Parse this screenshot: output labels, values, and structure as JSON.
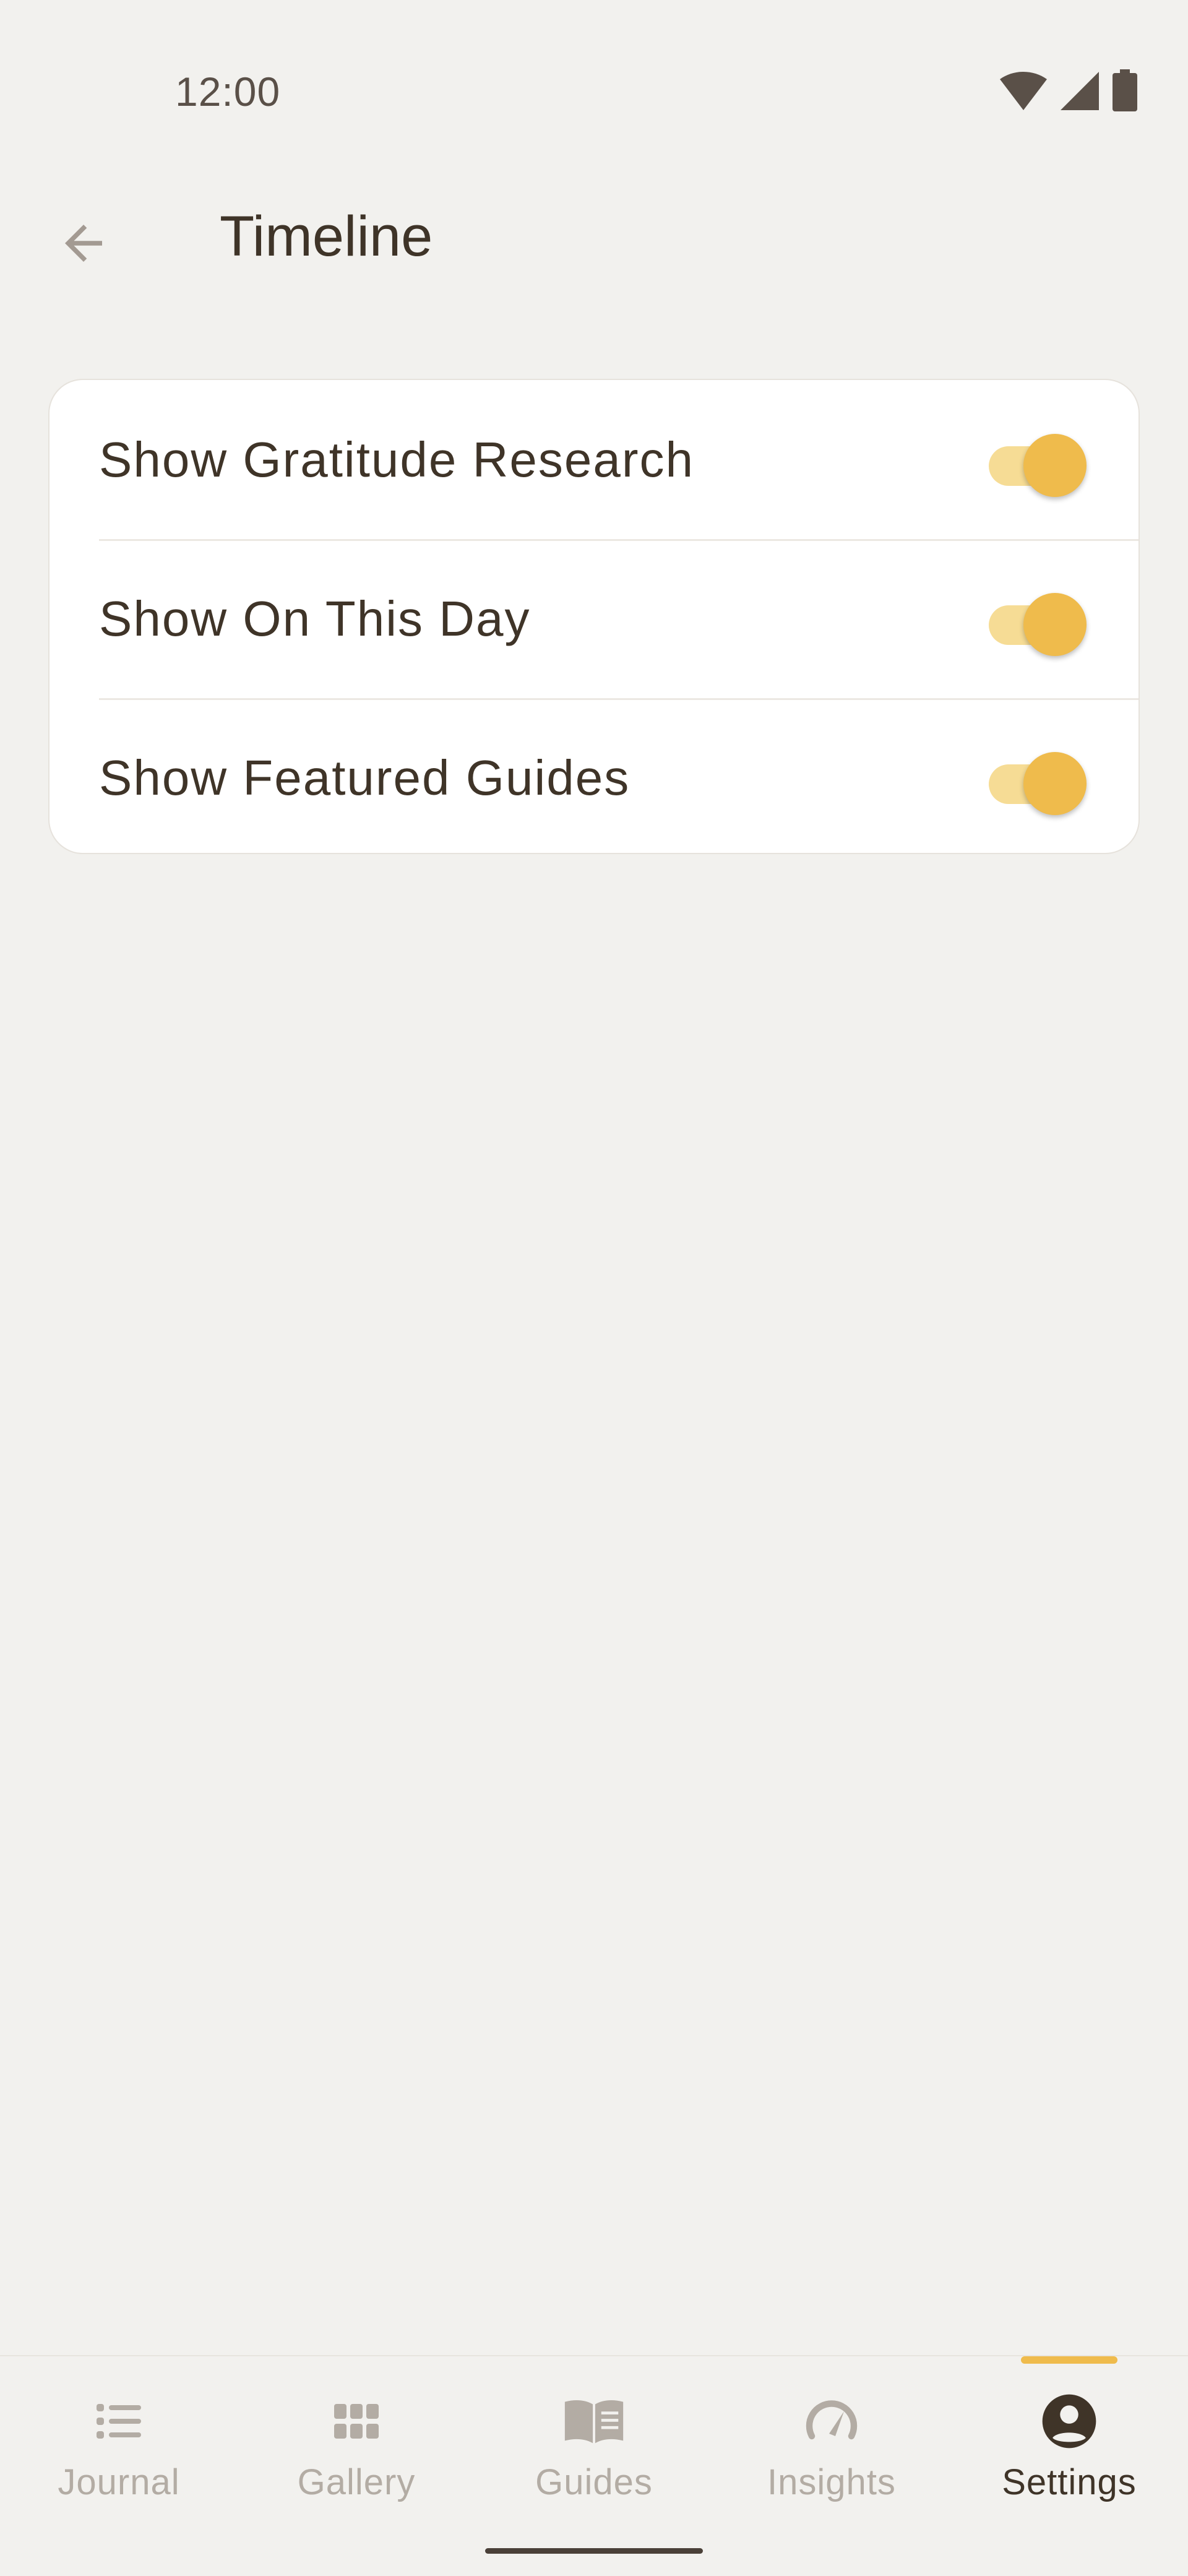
{
  "status_bar": {
    "time": "12:00",
    "icons": [
      "wifi-icon",
      "signal-icon",
      "battery-icon"
    ]
  },
  "header": {
    "back_icon": "arrow-left-icon",
    "title": "Timeline"
  },
  "settings": {
    "items": [
      {
        "label": "Show Gratitude Research",
        "enabled": true
      },
      {
        "label": "Show On This Day",
        "enabled": true
      },
      {
        "label": "Show Featured Guides",
        "enabled": true
      }
    ]
  },
  "bottom_nav": {
    "items": [
      {
        "label": "Journal",
        "icon": "list-icon",
        "active": false
      },
      {
        "label": "Gallery",
        "icon": "grid-icon",
        "active": false
      },
      {
        "label": "Guides",
        "icon": "book-icon",
        "active": false
      },
      {
        "label": "Insights",
        "icon": "gauge-icon",
        "active": false
      },
      {
        "label": "Settings",
        "icon": "account-icon",
        "active": true
      }
    ]
  },
  "colors": {
    "background": "#f2f1ee",
    "card": "#ffffff",
    "text": "#3f3428",
    "accent": "#efbb4c",
    "accent_light": "#f6dc95",
    "inactive": "#b3aca4"
  }
}
